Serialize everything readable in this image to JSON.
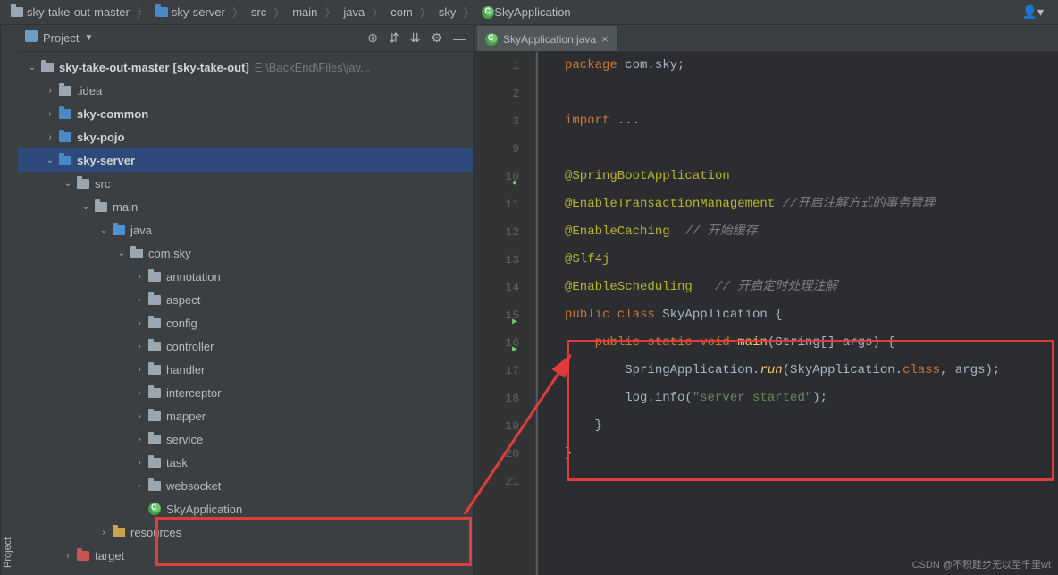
{
  "breadcrumb": [
    {
      "label": "sky-take-out-master",
      "icon": "folder"
    },
    {
      "label": "sky-server",
      "icon": "module"
    },
    {
      "label": "src",
      "icon": null
    },
    {
      "label": "main",
      "icon": null
    },
    {
      "label": "java",
      "icon": null
    },
    {
      "label": "com",
      "icon": null
    },
    {
      "label": "sky",
      "icon": null
    },
    {
      "label": "SkyApplication",
      "icon": "class"
    }
  ],
  "projectPanel": {
    "title": "Project"
  },
  "tree": [
    {
      "indent": 0,
      "arrow": "down",
      "icon": "folder",
      "label": "sky-take-out-master",
      "bold": true,
      "bracket": "[sky-take-out]",
      "path": "E:\\BackEnd\\Files\\jav..."
    },
    {
      "indent": 1,
      "arrow": "right",
      "icon": "folder",
      "label": ".idea"
    },
    {
      "indent": 1,
      "arrow": "right",
      "icon": "module",
      "label": "sky-common",
      "bold": true
    },
    {
      "indent": 1,
      "arrow": "right",
      "icon": "module",
      "label": "sky-pojo",
      "bold": true
    },
    {
      "indent": 1,
      "arrow": "down",
      "icon": "module",
      "label": "sky-server",
      "bold": true,
      "selected": true
    },
    {
      "indent": 2,
      "arrow": "down",
      "icon": "folder",
      "label": "src"
    },
    {
      "indent": 3,
      "arrow": "down",
      "icon": "folder",
      "label": "main"
    },
    {
      "indent": 4,
      "arrow": "down",
      "icon": "source",
      "label": "java"
    },
    {
      "indent": 5,
      "arrow": "down",
      "icon": "folder",
      "label": "com.sky"
    },
    {
      "indent": 6,
      "arrow": "right",
      "icon": "folder",
      "label": "annotation"
    },
    {
      "indent": 6,
      "arrow": "right",
      "icon": "folder",
      "label": "aspect"
    },
    {
      "indent": 6,
      "arrow": "right",
      "icon": "folder",
      "label": "config"
    },
    {
      "indent": 6,
      "arrow": "right",
      "icon": "folder",
      "label": "controller"
    },
    {
      "indent": 6,
      "arrow": "right",
      "icon": "folder",
      "label": "handler"
    },
    {
      "indent": 6,
      "arrow": "right",
      "icon": "folder",
      "label": "interceptor"
    },
    {
      "indent": 6,
      "arrow": "right",
      "icon": "folder",
      "label": "mapper"
    },
    {
      "indent": 6,
      "arrow": "right",
      "icon": "folder",
      "label": "service"
    },
    {
      "indent": 6,
      "arrow": "right",
      "icon": "folder",
      "label": "task"
    },
    {
      "indent": 6,
      "arrow": "right",
      "icon": "folder",
      "label": "websocket"
    },
    {
      "indent": 6,
      "arrow": "",
      "icon": "class",
      "label": "SkyApplication"
    },
    {
      "indent": 4,
      "arrow": "right",
      "icon": "resources",
      "label": "resources"
    },
    {
      "indent": 2,
      "arrow": "right",
      "icon": "excluded",
      "label": "target"
    }
  ],
  "editor": {
    "tab": {
      "label": "SkyApplication.java"
    },
    "lines": [
      {
        "num": "1",
        "tokens": [
          {
            "t": "kw",
            "s": "package "
          },
          {
            "t": "plain",
            "s": "com.sky;"
          }
        ]
      },
      {
        "num": "2",
        "tokens": []
      },
      {
        "num": "3",
        "tokens": [
          {
            "t": "kw",
            "s": "import "
          },
          {
            "t": "plain",
            "s": "..."
          }
        ]
      },
      {
        "num": "9",
        "tokens": []
      },
      {
        "num": "10",
        "marker": "green",
        "tokens": [
          {
            "t": "annotation",
            "s": "@SpringBootApplication"
          }
        ]
      },
      {
        "num": "11",
        "tokens": [
          {
            "t": "annotation",
            "s": "@EnableTransactionManagement"
          },
          {
            "t": "plain",
            "s": " "
          },
          {
            "t": "comment",
            "s": "//开启注解方式的事务管理"
          }
        ]
      },
      {
        "num": "12",
        "tokens": [
          {
            "t": "annotation",
            "s": "@EnableCaching"
          },
          {
            "t": "plain",
            "s": "  "
          },
          {
            "t": "comment",
            "s": "// 开始缓存"
          }
        ]
      },
      {
        "num": "13",
        "tokens": [
          {
            "t": "annotation",
            "s": "@Slf4j"
          }
        ]
      },
      {
        "num": "14",
        "tokens": [
          {
            "t": "annotation",
            "s": "@EnableScheduling"
          },
          {
            "t": "plain",
            "s": "   "
          },
          {
            "t": "comment",
            "s": "// 开启定时处理注解"
          }
        ]
      },
      {
        "num": "15",
        "marker": "play",
        "tokens": [
          {
            "t": "kw",
            "s": "public class "
          },
          {
            "t": "classname",
            "s": "SkyApplication"
          },
          {
            "t": "plain",
            "s": " {"
          }
        ]
      },
      {
        "num": "16",
        "marker": "play",
        "tokens": [
          {
            "t": "plain",
            "s": "    "
          },
          {
            "t": "kw",
            "s": "public static void "
          },
          {
            "t": "method",
            "s": "main"
          },
          {
            "t": "plain",
            "s": "(String[] args) {"
          }
        ]
      },
      {
        "num": "17",
        "tokens": [
          {
            "t": "plain",
            "s": "        SpringApplication."
          },
          {
            "t": "static-method",
            "s": "run"
          },
          {
            "t": "plain",
            "s": "(SkyApplication."
          },
          {
            "t": "kw",
            "s": "class"
          },
          {
            "t": "plain",
            "s": ", args);"
          }
        ]
      },
      {
        "num": "18",
        "tokens": [
          {
            "t": "plain",
            "s": "        log.info("
          },
          {
            "t": "str",
            "s": "\"server started\""
          },
          {
            "t": "plain",
            "s": ");"
          }
        ]
      },
      {
        "num": "19",
        "tokens": [
          {
            "t": "plain",
            "s": "    }"
          }
        ]
      },
      {
        "num": "20",
        "tokens": [
          {
            "t": "plain",
            "s": "}"
          }
        ]
      },
      {
        "num": "21",
        "tokens": []
      }
    ]
  },
  "watermark": "CSDN @不积跬步无以至千里wt"
}
